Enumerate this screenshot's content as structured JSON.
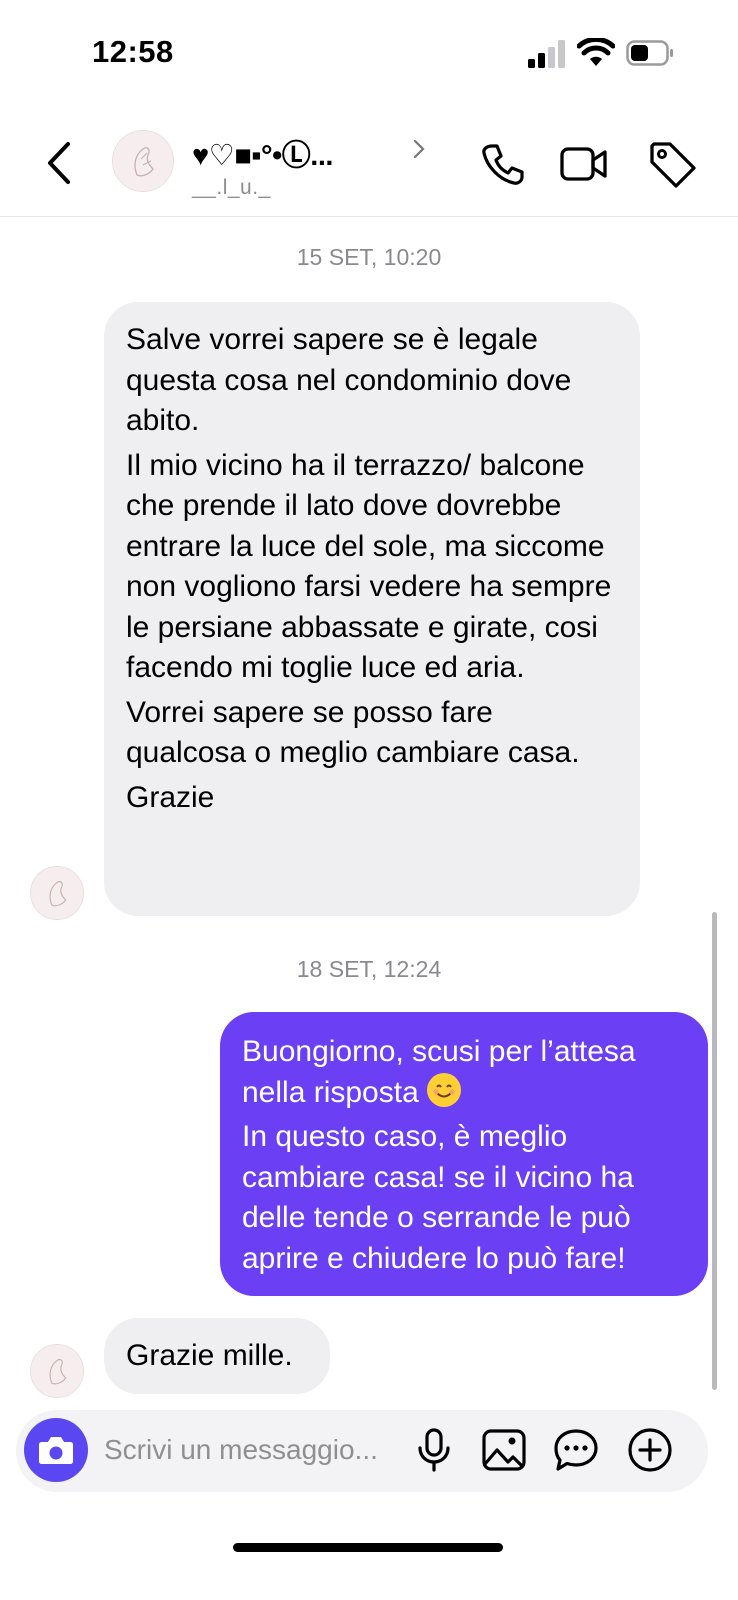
{
  "status_bar": {
    "time": "12:58"
  },
  "header": {
    "contact_name": "♥♡■▪︎°•Ⓛ...",
    "contact_handle": "__.l_u._"
  },
  "conversation": {
    "groups": [
      {
        "timestamp": "15 SET, 10:20",
        "received_paragraphs": [
          "Salve vorrei sapere se è legale questa cosa nel condominio dove abito.",
          "Il mio vicino ha il terrazzo/ balcone che prende il lato dove dovrebbe entrare la luce del sole, ma siccome non vogliono farsi vedere ha sempre le persiane abbassate e girate, cosi facendo mi toglie luce ed aria.",
          "Vorrei sapere se posso fare qualcosa o meglio cambiare casa.",
          "Grazie"
        ]
      },
      {
        "timestamp": "18 SET, 12:24",
        "sent_paragraphs": [
          "Buongiorno, scusi per l’attesa nella risposta",
          "In questo caso, è meglio cambiare casa! se il vicino ha delle tende o serrande le può aprire e chiudere lo può fare!"
        ],
        "reply": "Grazie mille."
      }
    ]
  },
  "composer": {
    "placeholder": "Scrivi un messaggio..."
  },
  "colors": {
    "sent_bubble": "#6b40f5",
    "received_bubble": "#efeff2",
    "camera_button": "#5a47f2"
  },
  "icons": [
    "back-icon",
    "call-icon",
    "video-icon",
    "tag-icon",
    "camera-icon",
    "mic-icon",
    "gallery-icon",
    "sticker-icon",
    "plus-icon"
  ]
}
